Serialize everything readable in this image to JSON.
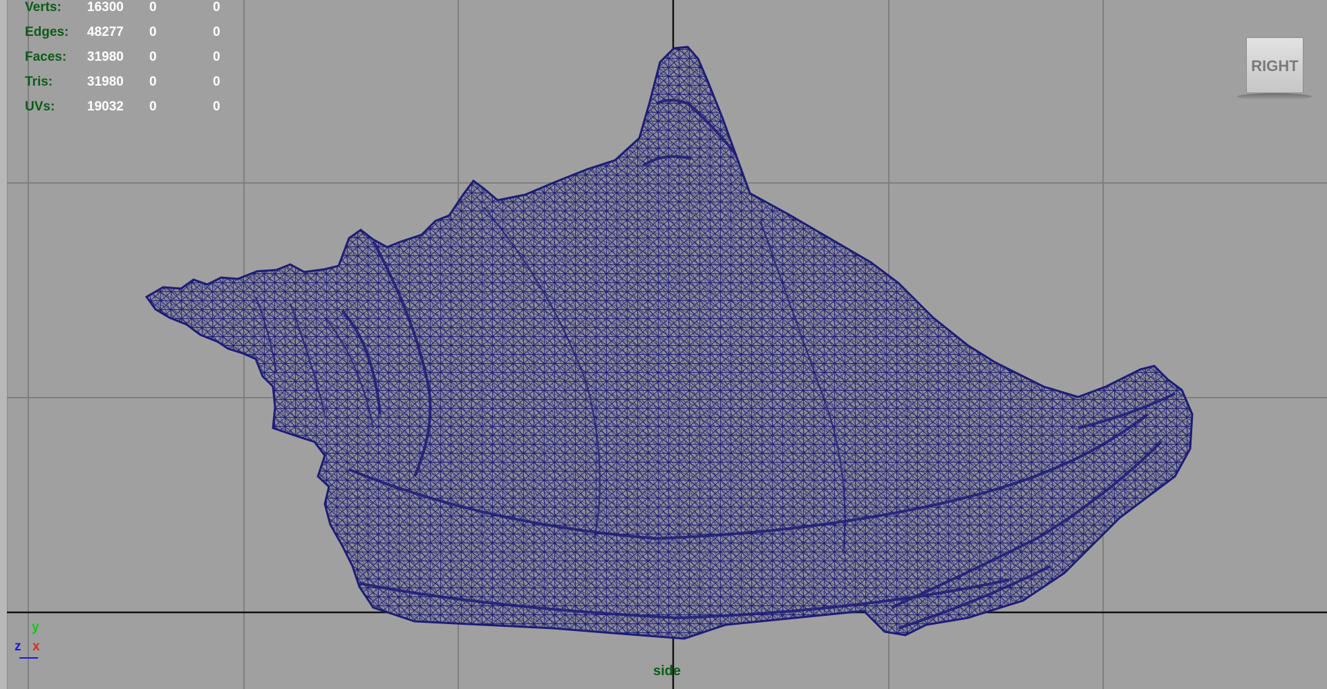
{
  "stats": [
    {
      "label": "Verts:",
      "values": [
        "16300",
        "0",
        "0"
      ]
    },
    {
      "label": "Edges:",
      "values": [
        "48277",
        "0",
        "0"
      ]
    },
    {
      "label": "Faces:",
      "values": [
        "31980",
        "0",
        "0"
      ]
    },
    {
      "label": "Tris:",
      "values": [
        "31980",
        "0",
        "0"
      ]
    },
    {
      "label": "UVs:",
      "values": [
        "19032",
        "0",
        "0"
      ]
    }
  ],
  "view_cube": {
    "label": "RIGHT"
  },
  "camera": {
    "name": "side"
  },
  "axis": {
    "y": "y",
    "z": "z",
    "x": "x"
  },
  "colors": {
    "background": "#a0a0a0",
    "grid": "#7f7f7f",
    "axis_line": "#111111",
    "wireframe": "#1c1c78",
    "hud_label": "#0a5c16",
    "hud_value": "#ffffff"
  },
  "icons": [
    "view-cube-icon",
    "axis-gizmo-icon"
  ]
}
